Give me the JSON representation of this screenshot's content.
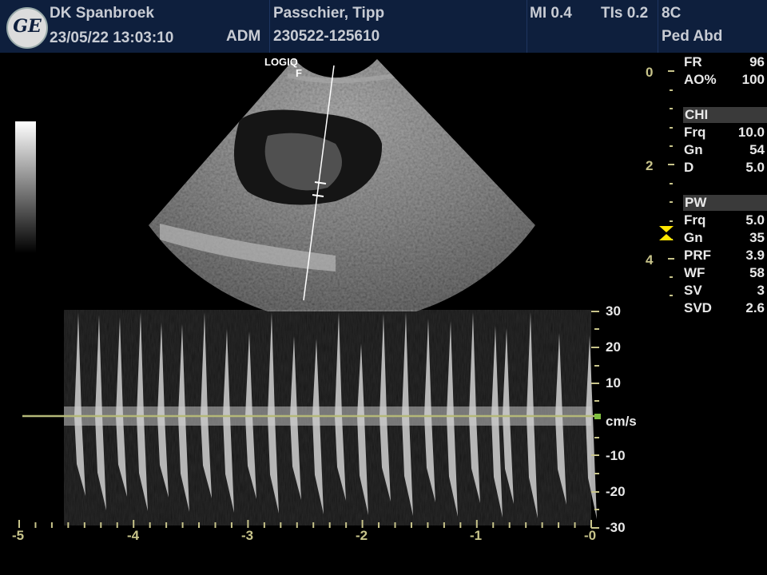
{
  "header": {
    "site": "DK Spanbroek",
    "datetime": "23/05/22 13:03:10",
    "operator": "ADM",
    "patient_name": "Passchier, Tipp",
    "patient_id": "230522-125610",
    "mi": "MI 0.4",
    "tis": "TIs 0.2",
    "probe": "8C",
    "preset": "Ped Abd",
    "logo_text": "GE"
  },
  "scan": {
    "logo_line1": "LOGIQ",
    "logo_line2": "F"
  },
  "params": {
    "top": [
      {
        "key": "FR",
        "value": "96"
      },
      {
        "key": "AO%",
        "value": "100"
      }
    ],
    "chi_title": "CHI",
    "chi": [
      {
        "key": "Frq",
        "value": "10.0"
      },
      {
        "key": "Gn",
        "value": "54"
      },
      {
        "key": "D",
        "value": "5.0"
      }
    ],
    "pw_title": "PW",
    "pw": [
      {
        "key": "Frq",
        "value": "5.0"
      },
      {
        "key": "Gn",
        "value": "35"
      },
      {
        "key": "PRF",
        "value": "3.9"
      },
      {
        "key": "WF",
        "value": "58"
      },
      {
        "key": "SV",
        "value": "3"
      },
      {
        "key": "SVD",
        "value": "2.6"
      }
    ]
  },
  "depth_scale": [
    "0",
    "2",
    "4"
  ],
  "doppler": {
    "velocity_labels": [
      "30",
      "20",
      "10",
      "-10",
      "-20",
      "-30"
    ],
    "velocity_unit": "cm/s",
    "time_labels": [
      "-5",
      "-4",
      "-3",
      "-2",
      "-1",
      "-0"
    ]
  },
  "colors": {
    "header_bg": "#0e1f3d",
    "scale_yellow": "#c8c48a",
    "baseline": "#b4b878"
  }
}
